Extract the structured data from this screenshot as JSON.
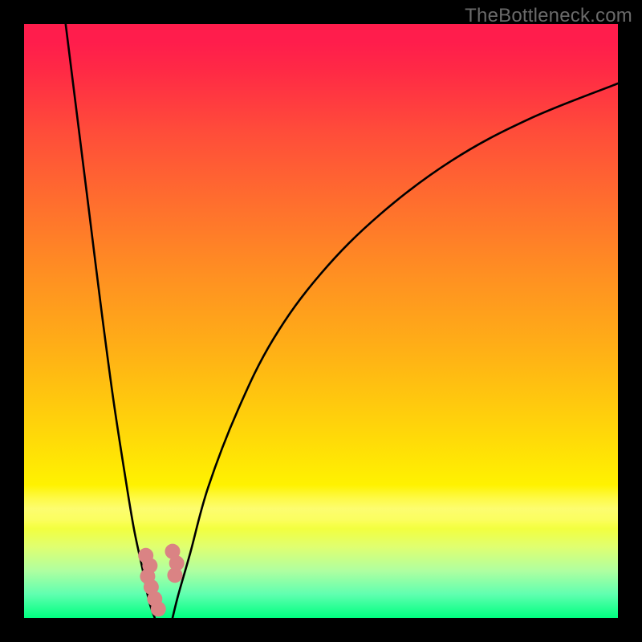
{
  "watermark": "TheBottleneck.com",
  "colors": {
    "background": "#000000",
    "curve": "#000000",
    "dot": "#da8384",
    "gradient_top": "#ff1d4c",
    "gradient_bottom": "#00ff80"
  },
  "chart_data": {
    "type": "line",
    "title": "",
    "xlabel": "",
    "ylabel": "",
    "xlim": [
      0,
      100
    ],
    "ylim": [
      0,
      100
    ],
    "grid": false,
    "legend": false,
    "series": [
      {
        "name": "left_curve",
        "x": [
          7,
          9,
          11,
          13,
          15,
          17,
          18.5,
          20,
          21,
          22
        ],
        "y": [
          100,
          84,
          68,
          52,
          37,
          24,
          15,
          8,
          3,
          0
        ]
      },
      {
        "name": "right_curve",
        "x": [
          25,
          26,
          28,
          31,
          36,
          42,
          50,
          60,
          72,
          85,
          100
        ],
        "y": [
          0,
          4,
          11,
          22,
          35,
          47,
          58,
          68,
          77,
          84,
          90
        ]
      }
    ],
    "dots": {
      "name": "bottom_dots",
      "x": [
        20.5,
        21.2,
        20.8,
        21.4,
        22.0,
        22.6,
        25.0,
        25.7,
        25.4
      ],
      "y": [
        10.5,
        8.8,
        7.0,
        5.2,
        3.2,
        1.5,
        11.2,
        9.2,
        7.2
      ]
    },
    "color_scale_note": "vertical gradient: red (top) → yellow (mid) → green (bottom)"
  }
}
